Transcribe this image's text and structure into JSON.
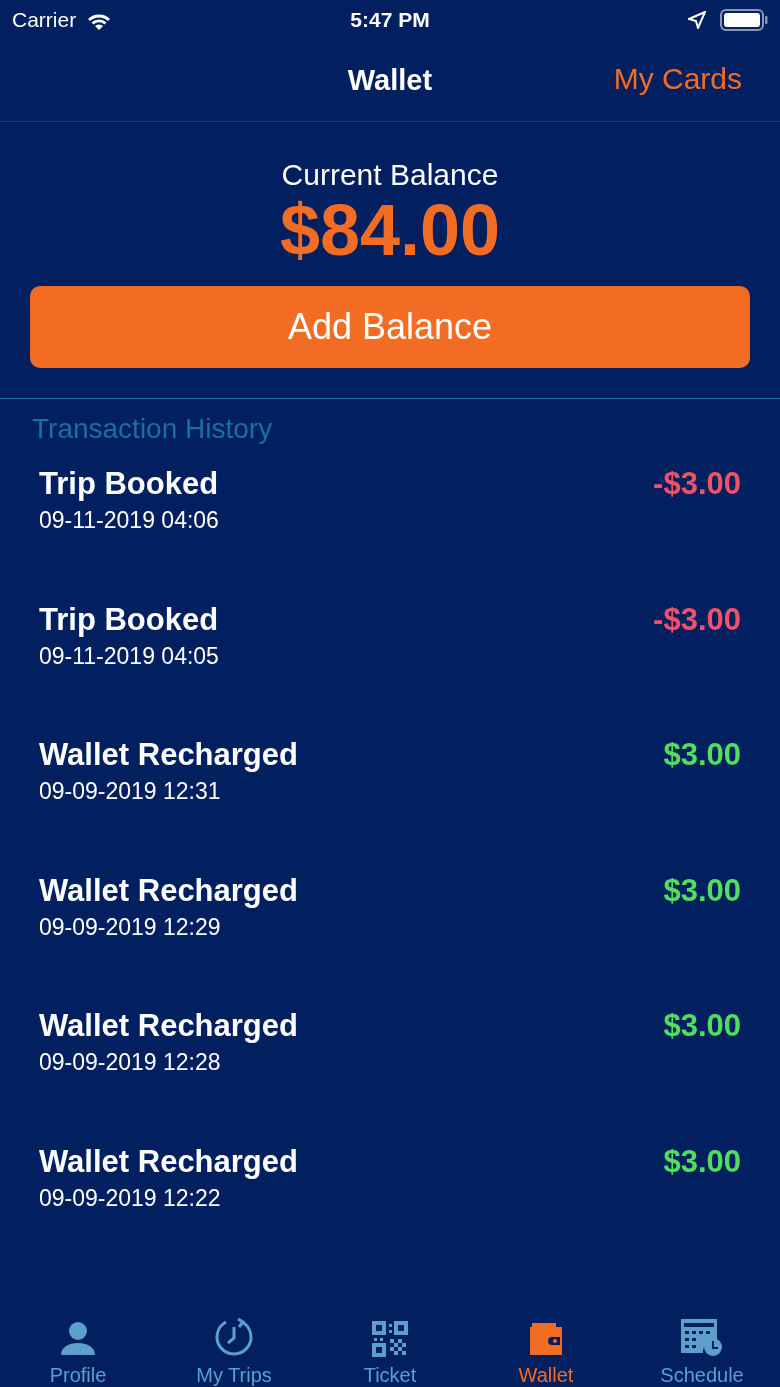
{
  "status_bar": {
    "carrier": "Carrier",
    "time": "5:47 PM"
  },
  "nav": {
    "title": "Wallet",
    "action": "My Cards"
  },
  "balance": {
    "label": "Current Balance",
    "amount": "$84.00",
    "button": "Add Balance"
  },
  "history": {
    "heading": "Transaction History",
    "transactions": [
      {
        "title": "Trip Booked",
        "date": "09-11-2019 04:06",
        "amount": "-$3.00",
        "kind": "debit"
      },
      {
        "title": "Trip Booked",
        "date": "09-11-2019 04:05",
        "amount": "-$3.00",
        "kind": "debit"
      },
      {
        "title": "Wallet Recharged",
        "date": "09-09-2019 12:31",
        "amount": "$3.00",
        "kind": "credit"
      },
      {
        "title": "Wallet Recharged",
        "date": "09-09-2019 12:29",
        "amount": "$3.00",
        "kind": "credit"
      },
      {
        "title": "Wallet Recharged",
        "date": "09-09-2019 12:28",
        "amount": "$3.00",
        "kind": "credit"
      },
      {
        "title": "Wallet Recharged",
        "date": "09-09-2019 12:22",
        "amount": "$3.00",
        "kind": "credit"
      }
    ]
  },
  "tab_bar": [
    {
      "label": "Profile",
      "kind": "person",
      "selected": false
    },
    {
      "label": "My Trips",
      "kind": "clock",
      "selected": false
    },
    {
      "label": "Ticket",
      "kind": "qr",
      "selected": false
    },
    {
      "label": "Wallet",
      "kind": "wallet",
      "selected": true
    },
    {
      "label": "Schedule",
      "kind": "calendar",
      "selected": false
    }
  ]
}
